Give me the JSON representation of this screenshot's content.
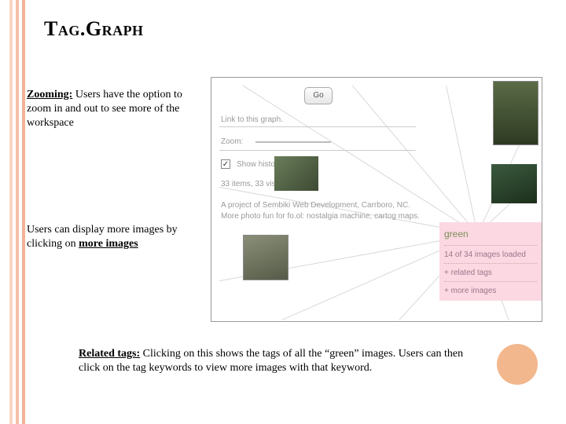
{
  "title": "Tag.Graph",
  "para1": {
    "lead": "Zooming:",
    "rest": " Users have the option to zoom in and out to see more of the workspace"
  },
  "para2": {
    "pre": "Users can display more images by clicking on ",
    "u": "more images"
  },
  "para3": {
    "lead": "Related tags:",
    "rest": " Clicking on this shows the tags of all the “green” images. Users can then click on the tag keywords to view more images with that keyword."
  },
  "panel": {
    "go": "Go",
    "link_graph": "Link to this graph.",
    "zoom_label": "Zoom:",
    "show_history": "Show history",
    "checkbox_mark": "✓",
    "items": "33 items, 33 visible.",
    "credit": "A project of Sembiki Web Development, Carrboro, NC. More photo fun for fo.ol: nostalgia machine, cartog maps."
  },
  "pink": {
    "tag": "green",
    "loaded": "14 of 34 images loaded",
    "related": "+ related tags",
    "more": "+ more images"
  }
}
